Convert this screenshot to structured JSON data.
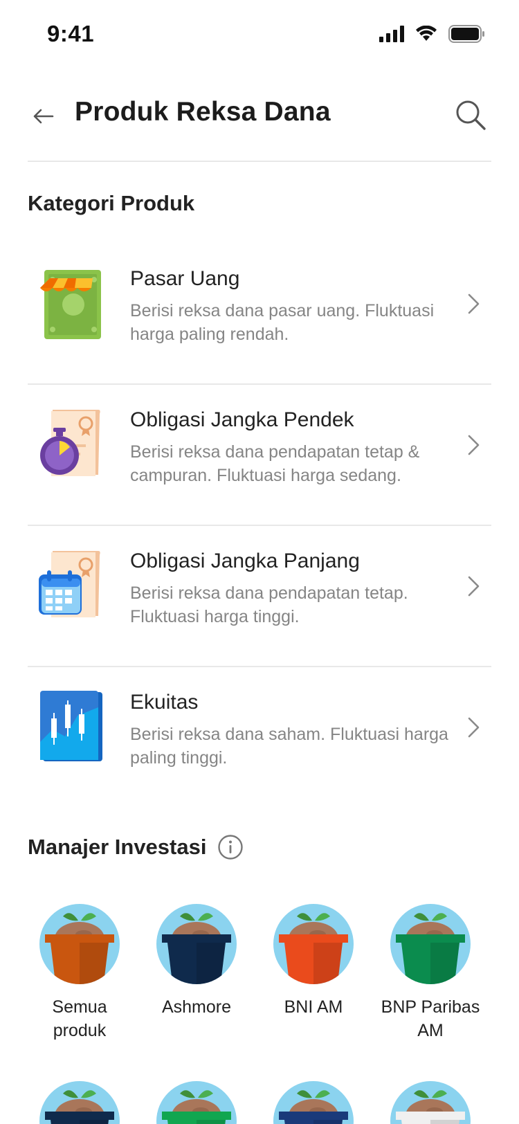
{
  "status_bar": {
    "time": "9:41"
  },
  "header": {
    "title": "Produk Reksa Dana"
  },
  "categories_section": {
    "title": "Kategori Produk",
    "items": [
      {
        "name": "Pasar Uang",
        "desc": "Berisi reksa dana pasar uang. Fluktuasi harga paling rendah."
      },
      {
        "name": "Obligasi Jangka Pendek",
        "desc": "Berisi reksa dana pendapatan tetap & campuran. Fluktuasi harga sedang."
      },
      {
        "name": "Obligasi Jangka Panjang",
        "desc": "Berisi reksa dana pendapatan tetap. Fluktuasi harga tinggi."
      },
      {
        "name": "Ekuitas",
        "desc": "Berisi reksa dana saham. Fluktuasi harga paling tinggi."
      }
    ]
  },
  "managers_section": {
    "title": "Manajer Investasi",
    "items": [
      {
        "name": "Semua produk",
        "pot_color": "#c9560f"
      },
      {
        "name": "Ashmore",
        "pot_color": "#0f2a4c"
      },
      {
        "name": "BNI AM",
        "pot_color": "#ea4b1c"
      },
      {
        "name": "BNP Paribas AM",
        "pot_color": "#0b8c4e"
      },
      {
        "name": "",
        "pot_color": "#0f2a4c"
      },
      {
        "name": "",
        "pot_color": "#11a650"
      },
      {
        "name": "",
        "pot_color": "#1a3a7a"
      },
      {
        "name": "",
        "pot_color": "#f0f0f0"
      }
    ]
  },
  "colors": {
    "accent_sky": "#8bd3ef",
    "text_primary": "#222222",
    "text_secondary": "#858585"
  }
}
